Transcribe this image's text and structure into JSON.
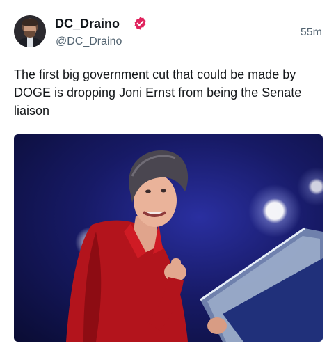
{
  "author": {
    "display_name": "DC_Draino",
    "handle": "@DC_Draino",
    "verified_icon": "verified-badge-icon",
    "verified_color": "#e0245e"
  },
  "tweet": {
    "time": "55m",
    "text": "The first big government cut that could be made by DOGE is dropping Joni Ernst from being the Senate liaison"
  },
  "media": {
    "type": "photo"
  }
}
